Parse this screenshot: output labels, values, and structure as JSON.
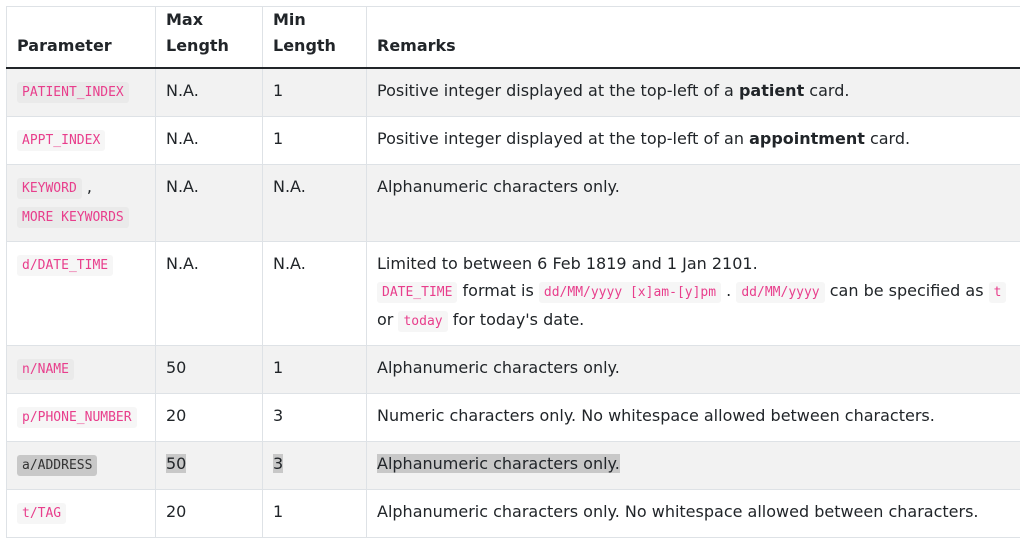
{
  "headers": {
    "parameter": "Parameter",
    "max_line1": "Max",
    "max_line2": "Length",
    "min_line1": "Min",
    "min_line2": "Length",
    "remarks": "Remarks"
  },
  "rows": [
    {
      "param": "PATIENT_INDEX",
      "max": "N.A.",
      "min": "1",
      "remark_pre": "Positive integer displayed at the top-left of a ",
      "remark_bold": "patient",
      "remark_post": " card."
    },
    {
      "param": "APPT_INDEX",
      "max": "N.A.",
      "min": "1",
      "remark_pre": "Positive integer displayed at the top-left of an ",
      "remark_bold": "appointment",
      "remark_post": " card."
    },
    {
      "param": "KEYWORD",
      "param_sep": ",",
      "param2": "MORE KEYWORDS",
      "max": "N.A.",
      "min": "N.A.",
      "remark": "Alphanumeric characters only."
    },
    {
      "param": "d/DATE_TIME",
      "max": "N.A.",
      "min": "N.A.",
      "line1": "Limited to between 6 Feb 1819 and 1 Jan 2101.",
      "code_a": "DATE_TIME",
      "text_a": "format is",
      "code_b": "dd/MM/yyyy [x]am-[y]pm",
      "text_b": ".",
      "code_c": "dd/MM/yyyy",
      "text_c": "can be specified as",
      "code_d": "t",
      "text_d": "or",
      "code_e": "today",
      "text_e": "for today's date."
    },
    {
      "param": "n/NAME",
      "max": "50",
      "min": "1",
      "remark": "Alphanumeric characters only."
    },
    {
      "param": "p/PHONE_NUMBER",
      "max": "20",
      "min": "3",
      "remark": "Numeric characters only. No whitespace allowed between characters."
    },
    {
      "param": "a/ADDRESS",
      "max": "50",
      "min": "3",
      "remark": "Alphanumeric characters only."
    },
    {
      "param": "t/TAG",
      "max": "20",
      "min": "1",
      "remark": "Alphanumeric characters only. No whitespace allowed between characters."
    }
  ],
  "colors": {
    "code_text": "#e83e8c",
    "stripe": "#f2f2f2",
    "highlight": "#c8c8c8"
  }
}
